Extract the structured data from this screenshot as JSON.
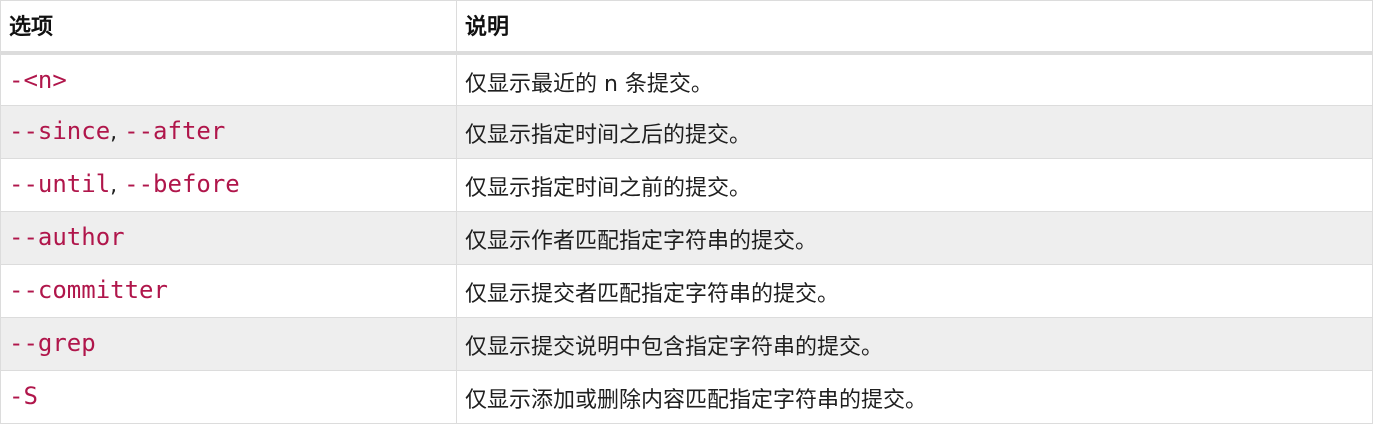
{
  "header": {
    "col1": "选项",
    "col2": "说明"
  },
  "rows": [
    {
      "options": [
        "-<n>"
      ],
      "desc": "仅显示最近的 n 条提交。"
    },
    {
      "options": [
        "--since",
        "--after"
      ],
      "desc": "仅显示指定时间之后的提交。"
    },
    {
      "options": [
        "--until",
        "--before"
      ],
      "desc": "仅显示指定时间之前的提交。"
    },
    {
      "options": [
        "--author"
      ],
      "desc": "仅显示作者匹配指定字符串的提交。"
    },
    {
      "options": [
        "--committer"
      ],
      "desc": "仅显示提交者匹配指定字符串的提交。"
    },
    {
      "options": [
        "--grep"
      ],
      "desc": "仅显示提交说明中包含指定字符串的提交。"
    },
    {
      "options": [
        "-S"
      ],
      "desc": "仅显示添加或删除内容匹配指定字符串的提交。"
    }
  ],
  "separator": ", ",
  "colors": {
    "option_text": "#b0164b",
    "stripe": "#eeeeee",
    "border": "#dcdcdc"
  }
}
